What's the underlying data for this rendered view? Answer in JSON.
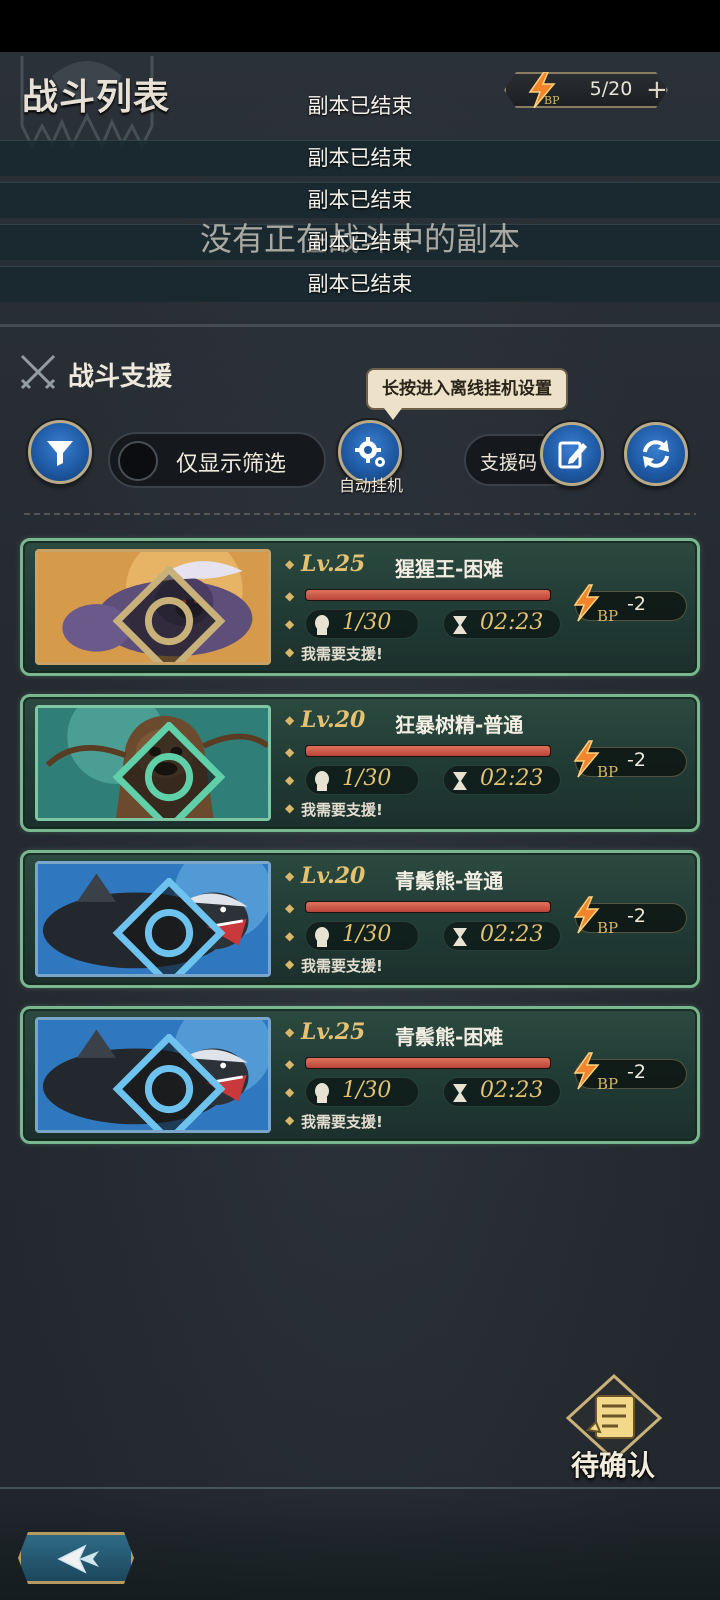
{
  "header": {
    "title": "战斗列表",
    "bp_value": "5/20",
    "bp_plus": "+"
  },
  "battle_list": {
    "ended_messages": [
      "副本已结束",
      "副本已结束",
      "副本已结束",
      "副本已结束",
      "副本已结束"
    ],
    "empty_message": "没有正在战斗中的副本"
  },
  "support": {
    "title": "战斗支援",
    "tooltip": "长按进入离线挂机设置",
    "filter_toggle_label": "仅显示筛选",
    "auto_label": "自动挂机",
    "code_label": "支援码"
  },
  "cards": [
    {
      "level": "Lv.25",
      "name": "猩猩王-困难",
      "hp": 1.0,
      "players": "1/30",
      "time": "02:23",
      "need": "我需要支援!",
      "bp_cost": "-2",
      "bp_label": "BP",
      "element_color": "#c9b27a",
      "frame_color": "#c7a36a"
    },
    {
      "level": "Lv.20",
      "name": "狂暴树精-普通",
      "hp": 1.0,
      "players": "1/30",
      "time": "02:23",
      "need": "我需要支援!",
      "bp_cost": "-2",
      "bp_label": "BP",
      "element_color": "#5fd0a8",
      "frame_color": "#7fc6a2"
    },
    {
      "level": "Lv.20",
      "name": "青鬃熊-普通",
      "hp": 1.0,
      "players": "1/30",
      "time": "02:23",
      "need": "我需要支援!",
      "bp_cost": "-2",
      "bp_label": "BP",
      "element_color": "#6ec3ee",
      "frame_color": "#7aa7c9"
    },
    {
      "level": "Lv.25",
      "name": "青鬃熊-困难",
      "hp": 1.0,
      "players": "1/30",
      "time": "02:23",
      "need": "我需要支援!",
      "bp_cost": "-2",
      "bp_label": "BP",
      "element_color": "#6ec3ee",
      "frame_color": "#7aa7c9"
    }
  ],
  "pending": {
    "label": "待确认"
  },
  "icons": {
    "filter": "filter-icon",
    "auto": "gear-icon",
    "code": "edit-note-icon",
    "refresh": "refresh-icon",
    "back": "back-arrow-icon",
    "bp": "lightning-icon"
  }
}
